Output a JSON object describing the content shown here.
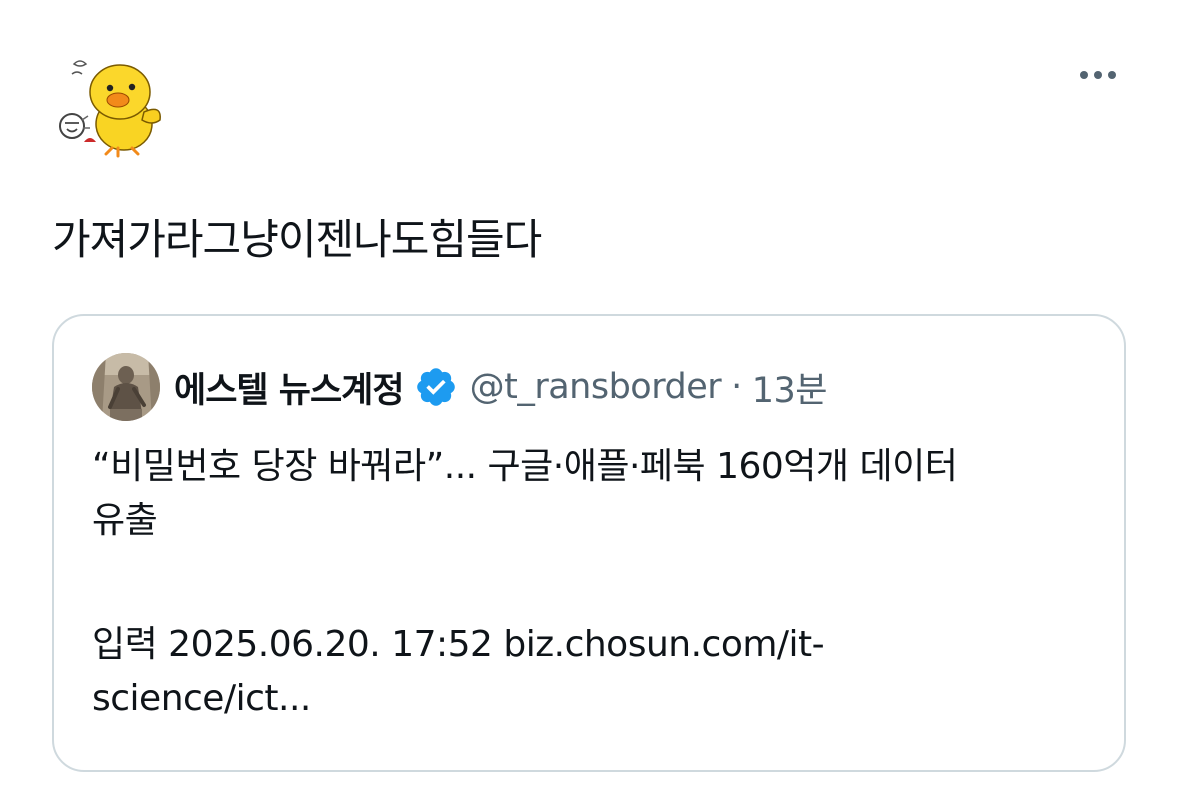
{
  "tweet": {
    "avatar_icon": "yellow-chick-sticker-icon",
    "more_icon": "more-options-icon",
    "text": "가져가라그냥이젠나도힘들다"
  },
  "quote": {
    "display_name": "에스텔 뉴스계정",
    "handle": "@t_ransborder",
    "separator": "·",
    "time": "13분",
    "verified_icon": "verified-badge-icon",
    "verified_color": "#1d9bf0",
    "body_lines": [
      "“비밀번호 당장 바꿔라”... 구글·애플·페북 160억개 데이터",
      "유출",
      "입력 2025.06.20. 17:52 biz.chosun.com/it-",
      "science/ict..."
    ]
  }
}
